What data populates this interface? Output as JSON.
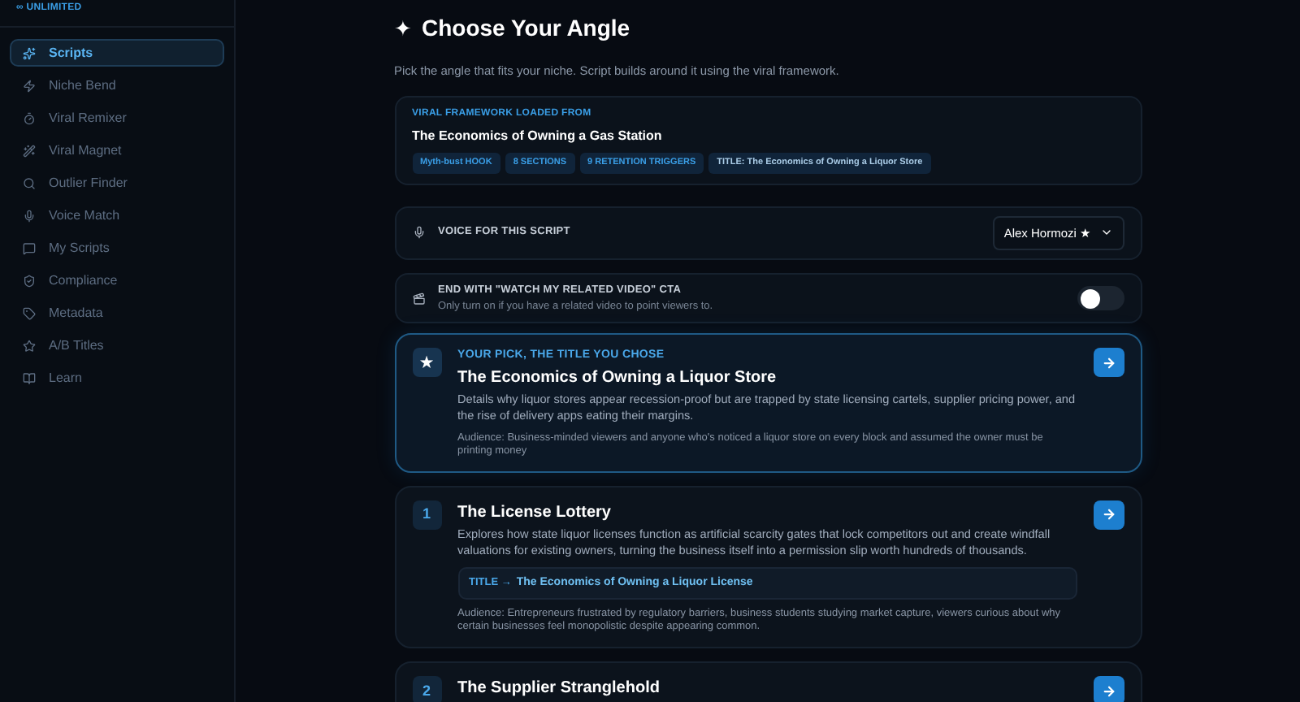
{
  "sidebar": {
    "brand": "∞ UNLIMITED",
    "items": [
      {
        "label": "Scripts",
        "selected": true
      },
      {
        "label": "Niche Bend",
        "selected": false
      },
      {
        "label": "Viral Remixer",
        "selected": false
      },
      {
        "label": "Viral Magnet",
        "selected": false
      },
      {
        "label": "Outlier Finder",
        "selected": false
      },
      {
        "label": "Voice Match",
        "selected": false
      },
      {
        "label": "My Scripts",
        "selected": false
      },
      {
        "label": "Compliance",
        "selected": false
      },
      {
        "label": "Metadata",
        "selected": false
      },
      {
        "label": "A/B Titles",
        "selected": false
      },
      {
        "label": "Learn",
        "selected": false
      }
    ]
  },
  "header": {
    "icon": "✦",
    "title": "Choose Your Angle",
    "subtitle": "Pick the angle that fits your niche. Script builds around it using the viral framework."
  },
  "framework": {
    "label": "VIRAL FRAMEWORK LOADED FROM",
    "title": "The Economics of Owning a Gas Station",
    "tags": [
      "Myth-bust HOOK",
      "8 SECTIONS",
      "9 RETENTION TRIGGERS",
      "TITLE: The Economics of Owning a Liquor Store"
    ]
  },
  "voice": {
    "label": "VOICE FOR THIS SCRIPT",
    "value": "Alex Hormozi ★"
  },
  "cta": {
    "label": "END WITH \"WATCH MY RELATED VIDEO\" CTA",
    "hint": "Only turn on if you have a related video to point viewers to.",
    "on": false
  },
  "angles": [
    {
      "kind": "pick",
      "badge": "★",
      "eyebrow": "YOUR PICK, THE TITLE YOU CHOSE",
      "title": "The Economics of Owning a Liquor Store",
      "description": "Details why liquor stores appear recession-proof but are trapped by state licensing cartels, supplier pricing power, and the rise of delivery apps eating their margins.",
      "audience": "Audience: Business-minded viewers and anyone who's noticed a liquor store on every block and assumed the owner must be printing money"
    },
    {
      "kind": "angle",
      "badge": "1",
      "title": "The License Lottery",
      "description": "Explores how state liquor licenses function as artificial scarcity gates that lock competitors out and create windfall valuations for existing owners, turning the business itself into a permission slip worth hundreds of thousands.",
      "title_label": "TITLE →",
      "suggested_title": "The Economics of Owning a Liquor License",
      "audience": "Audience: Entrepreneurs frustrated by regulatory barriers, business students studying market capture, viewers curious about why certain businesses feel monopolistic despite appearing common."
    },
    {
      "kind": "angle",
      "badge": "2",
      "title": "The Supplier Stranglehold"
    }
  ]
}
